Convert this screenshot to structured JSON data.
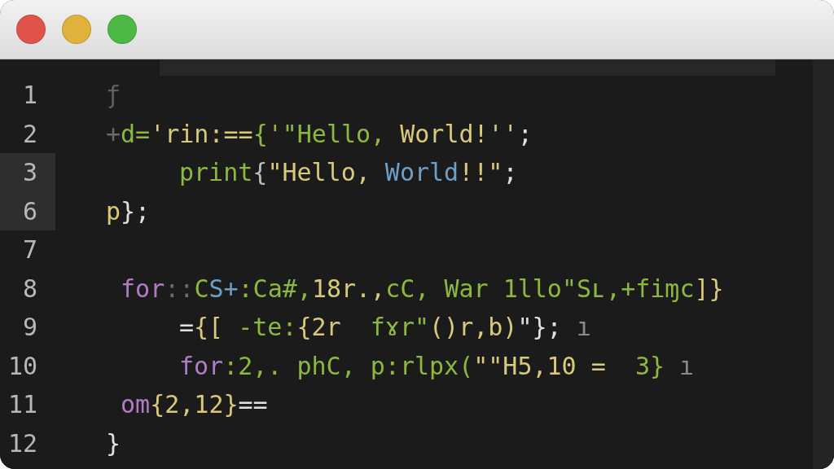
{
  "window": {
    "controls": [
      {
        "kind": "close"
      },
      {
        "kind": "minimize"
      },
      {
        "kind": "zoom"
      }
    ]
  },
  "editor": {
    "lines": [
      {
        "number": "1",
        "highlighted": false,
        "indent": false,
        "tokens": [
          {
            "text": "ƒ",
            "color": "#5e5e5e"
          }
        ]
      },
      {
        "number": "2",
        "highlighted": false,
        "indent": false,
        "tokens": [
          {
            "text": "+",
            "color": "#6a6a6a"
          },
          {
            "text": "d=",
            "color": "#8bb83f"
          },
          {
            "text": "'rin:==",
            "color": "#d9c97a"
          },
          {
            "text": "{'\"Hello,",
            "color": "#8bb83f"
          },
          {
            "text": " World!''",
            "color": "#d9c97a"
          },
          {
            "text": ";",
            "color": "#e0e0e0"
          }
        ]
      },
      {
        "number": "3",
        "highlighted": true,
        "indent": true,
        "tokens": [
          {
            "text": "print",
            "color": "#8bb83f"
          },
          {
            "text": "{",
            "color": "#bdbdbd"
          },
          {
            "text": "\"Hello,",
            "color": "#d9c97a"
          },
          {
            "text": " World",
            "color": "#6e9fc8"
          },
          {
            "text": "!!\"",
            "color": "#d9c97a"
          },
          {
            "text": ";",
            "color": "#e0e0e0"
          }
        ]
      },
      {
        "number": "6",
        "highlighted": true,
        "indent": false,
        "tokens": [
          {
            "text": "p",
            "color": "#d9c97a"
          },
          {
            "text": "};",
            "color": "#e0e0e0"
          }
        ]
      },
      {
        "number": "7",
        "highlighted": false
      },
      {
        "number": "8",
        "highlighted": false,
        "indent": false,
        "tokens": [
          {
            "text": " for",
            "color": "#b07cc6"
          },
          {
            "text": "::",
            "color": "#6a6a6a"
          },
          {
            "text": "C",
            "color": "#8bb83f"
          },
          {
            "text": "S+",
            "color": "#6e9fc8"
          },
          {
            "text": ":Ca#,",
            "color": "#8bb83f"
          },
          {
            "text": "18r.,",
            "color": "#d9c97a"
          },
          {
            "text": "cC, War 1llo\"Sʟ,+fiɱc",
            "color": "#8bb83f"
          },
          {
            "text": "]}",
            "color": "#d9c97a"
          }
        ]
      },
      {
        "number": "9",
        "highlighted": false,
        "indent": true,
        "tokens": [
          {
            "text": "=",
            "color": "#e0e0e0"
          },
          {
            "text": "{[",
            "color": "#d9c97a"
          },
          {
            "text": " -te:",
            "color": "#8bb83f"
          },
          {
            "text": "{2r",
            "color": "#d9c97a"
          },
          {
            "text": "  fɤr\"",
            "color": "#8bb83f"
          },
          {
            "text": "()r,b)",
            "color": "#d9c97a"
          },
          {
            "text": "\"};",
            "color": "#e0e0e0"
          },
          {
            "text": " ı",
            "color": "#8a8a8a"
          }
        ]
      },
      {
        "number": "10",
        "highlighted": false,
        "indent": true,
        "tokens": [
          {
            "text": "for",
            "color": "#b07cc6"
          },
          {
            "text": ":2,.",
            "color": "#8bb83f"
          },
          {
            "text": " phC, p:rlpx(",
            "color": "#8bb83f"
          },
          {
            "text": "\"\"H5,10 = ",
            "color": "#d9c97a"
          },
          {
            "text": " 3}",
            "color": "#8bb83f"
          },
          {
            "text": " ı",
            "color": "#8a8a8a"
          }
        ]
      },
      {
        "number": "11",
        "highlighted": false,
        "indent": false,
        "tokens": [
          {
            "text": " om",
            "color": "#b07cc6"
          },
          {
            "text": "{2,12}",
            "color": "#d9c97a"
          },
          {
            "text": "==",
            "color": "#e0e0e0"
          }
        ]
      },
      {
        "number": "12",
        "highlighted": false,
        "indent": false,
        "tokens": [
          {
            "text": "}",
            "color": "#e0e0e0"
          }
        ]
      }
    ]
  }
}
